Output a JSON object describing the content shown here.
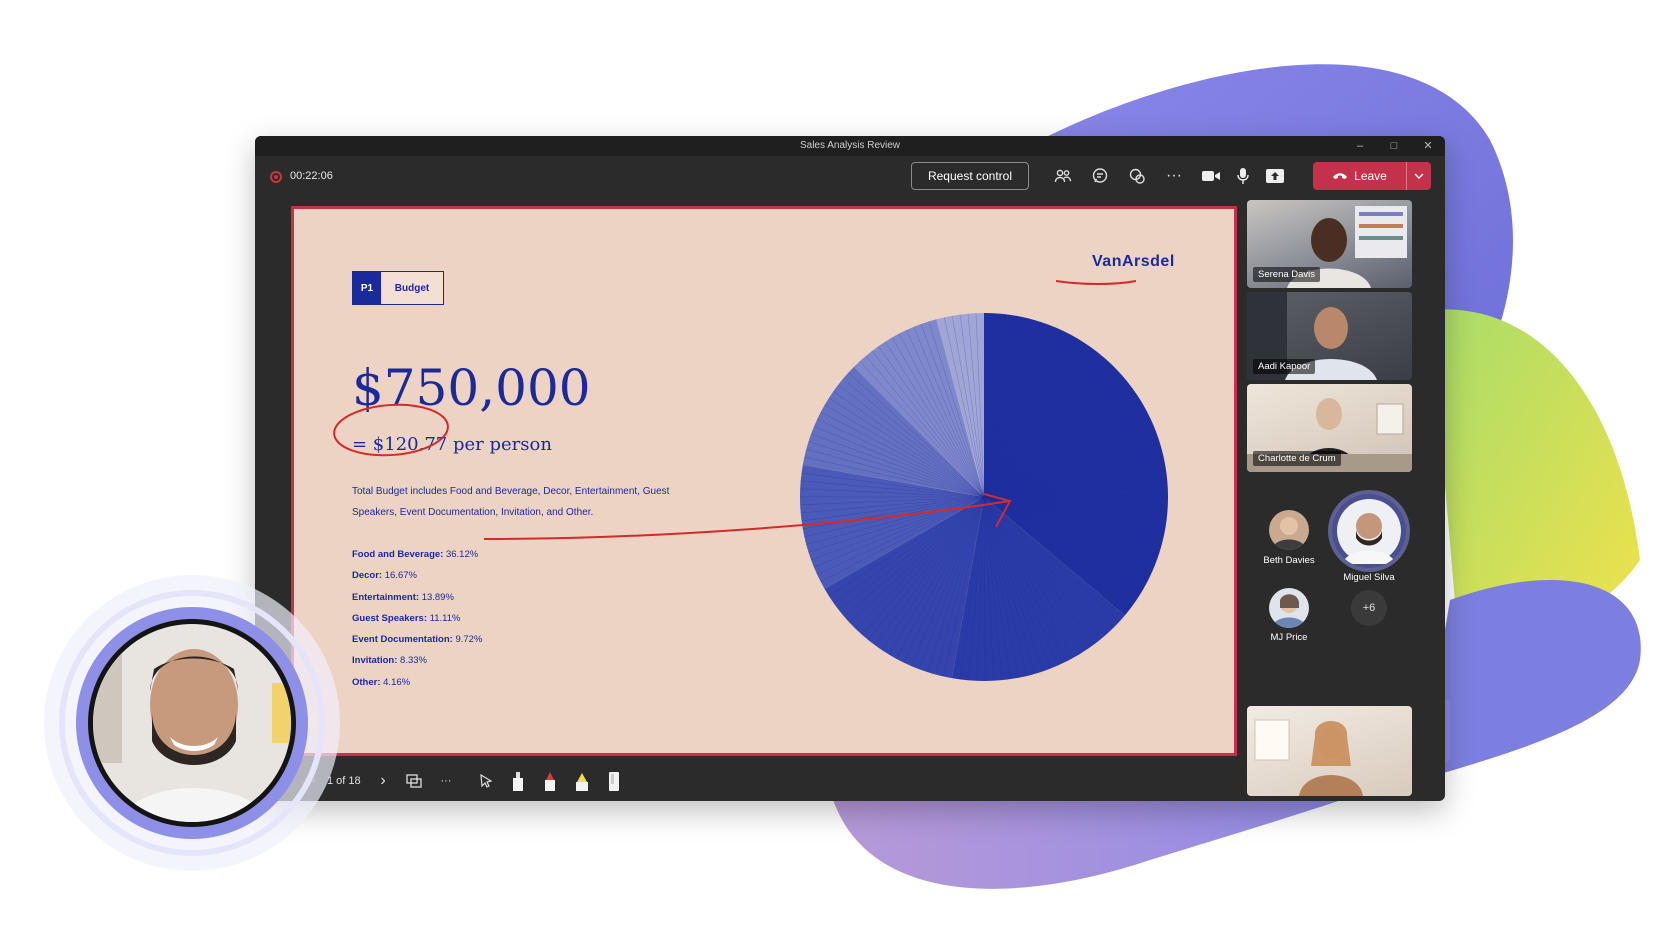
{
  "window": {
    "title": "Sales Analysis Review"
  },
  "toolbar": {
    "timer": "00:22:06",
    "request_control_label": "Request control",
    "leave_label": "Leave",
    "icons": [
      "people-icon",
      "chat-icon",
      "reactions-icon",
      "more-icon",
      "camera-icon",
      "mic-icon",
      "share-icon"
    ]
  },
  "slide": {
    "tag_number": "P1",
    "tag_label": "Budget",
    "brand": "VanArsdel",
    "total": "$750,000",
    "per_person": "= $120.77 per person",
    "description": "Total Budget includes Food and Beverage, Decor, Entertainment, Guest Speakers, Event Documentation, Invitation, and Other.",
    "breakdown": [
      {
        "label": "Food and Beverage:",
        "value": "36.12%"
      },
      {
        "label": "Decor:",
        "value": "16.67%"
      },
      {
        "label": "Entertainment:",
        "value": "13.89%"
      },
      {
        "label": "Guest Speakers:",
        "value": "11.11%"
      },
      {
        "label": "Event Documentation:",
        "value": "9.72%"
      },
      {
        "label": "Invitation:",
        "value": "8.33%"
      },
      {
        "label": "Other:",
        "value": "4.16%"
      }
    ]
  },
  "chart_data": {
    "type": "pie",
    "categories": [
      "Food and Beverage",
      "Decor",
      "Entertainment",
      "Guest Speakers",
      "Event Documentation",
      "Invitation",
      "Other"
    ],
    "values": [
      36.12,
      16.67,
      13.89,
      11.11,
      9.72,
      8.33,
      4.16
    ],
    "colors": [
      "#1f2f9e",
      "#2a3aa6",
      "#3545ad",
      "#4b5ab6",
      "#6470c0",
      "#7f88cb",
      "#a1a6d7"
    ]
  },
  "presenter_bar": {
    "page_indicator": "1 of 18"
  },
  "participants": {
    "tiles": [
      {
        "name": "Serena Davis"
      },
      {
        "name": "Aadi Kapoor"
      },
      {
        "name": "Charlotte de Crum"
      }
    ],
    "avatars": [
      {
        "name": "Beth Davies"
      },
      {
        "name": "Miguel Silva"
      },
      {
        "name": "MJ Price"
      }
    ],
    "overflow": "+6"
  },
  "theme": {
    "accent_red": "#c4314b",
    "slide_bg": "#edd3c4",
    "slide_ink": "#1b2a9a"
  }
}
